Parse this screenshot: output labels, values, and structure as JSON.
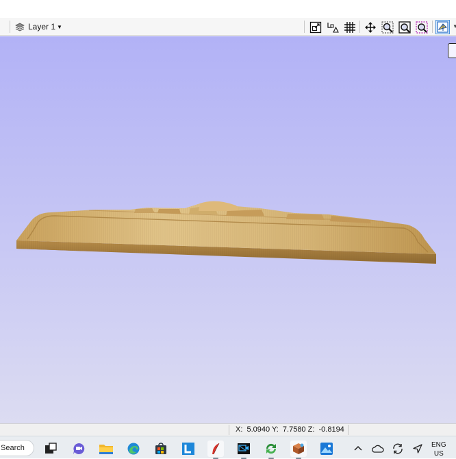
{
  "toolbar": {
    "layer_label": "Layer 1",
    "buttons": [
      {
        "name": "set-job-size-icon",
        "active": false
      },
      {
        "name": "snap-settings-icon",
        "active": false
      },
      {
        "name": "grid-icon",
        "active": false
      },
      {
        "name": "pan-icon",
        "active": false
      },
      {
        "name": "zoom-icon",
        "active": false
      },
      {
        "name": "zoom-extents-icon",
        "active": false
      },
      {
        "name": "zoom-selection-icon",
        "active": false
      },
      {
        "name": "toggle-view-icon",
        "active": true
      }
    ]
  },
  "viewport": {
    "background_top": "#b2b2f6",
    "background_bottom": "#dcdcf2",
    "model_color": "#d9b878"
  },
  "status": {
    "coordinates": "X:  5.0940 Y:  7.7580 Z:  -0.8194"
  },
  "taskbar": {
    "search_label": "Search",
    "apps": [
      "task-view-icon",
      "chat-icon",
      "file-explorer-icon",
      "edge-icon",
      "store-icon",
      "l-app-icon",
      "feather-app-icon",
      "media-app-icon",
      "cycle-app-icon",
      "cube-app-icon",
      "photos-icon"
    ],
    "tray": [
      "chevron-up-icon",
      "onedrive-icon",
      "sync-icon",
      "location-icon"
    ],
    "language": "ENG",
    "region": "US"
  }
}
